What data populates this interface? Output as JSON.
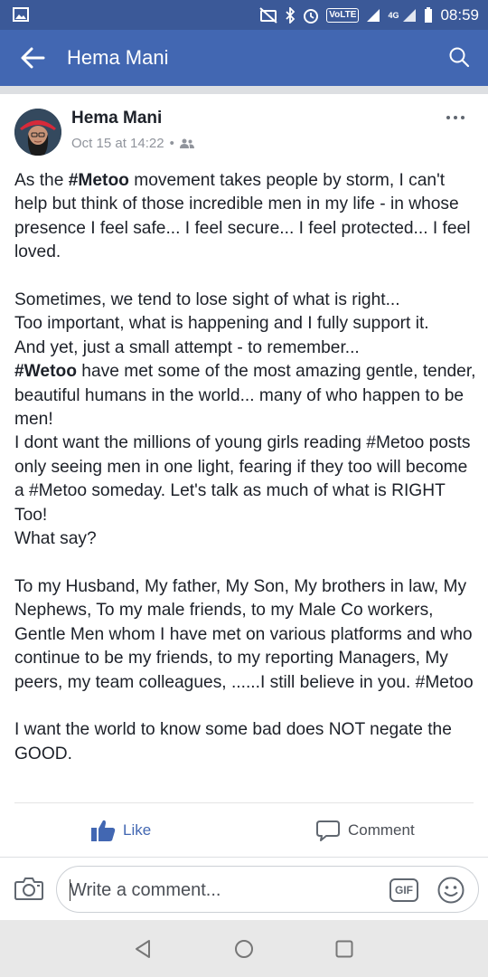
{
  "status_bar": {
    "volte": "VoLTE",
    "network": "4G",
    "time": "08:59"
  },
  "nav": {
    "title": "Hema Mani",
    "back_icon": "arrow-left-icon",
    "search_icon": "search-icon"
  },
  "post": {
    "author": "Hema Mani",
    "timestamp": "Oct 15 at 14:22",
    "separator": "•",
    "privacy_icon": "friends-icon",
    "more_icon": "more-horizontal-icon",
    "paragraph1": {
      "p1": "As the ",
      "tag1": "#Metoo",
      "p2": " movement takes people by storm, I can't help but think of those incredible men in my life - in whose presence I feel safe... I feel secure... I feel protected... I feel loved."
    },
    "paragraph2": {
      "line1": "Sometimes, we tend to lose sight of what is right...",
      "line2": "Too important, what is happening and I fully support it.",
      "line3": "And yet, just a small attempt - to remember...",
      "tag2": "#Wetoo",
      "line4": " have met some of the most amazing gentle, tender, beautiful humans in the world... many of who happen to be men!",
      "line5": "I dont want the millions of young girls reading #Metoo posts only seeing men in one light, fearing if they too will become a #Metoo someday. Let's talk as much of what is RIGHT Too!",
      "line6": "What say?"
    },
    "paragraph3": "To my Husband, My father, My Son, My brothers in law, My Nephews, To my male friends, to my Male Co workers, Gentle Men whom I have met on various platforms and who continue to be my friends, to my reporting Managers, My peers, my team colleagues, ......I still believe in you. #Metoo",
    "paragraph4": "I want the world to know some bad does NOT negate the GOOD.",
    "like_label": "Like",
    "comment_label": "Comment"
  },
  "composer": {
    "placeholder": "Write a comment...",
    "gif_label": "GIF"
  },
  "colors": {
    "status_bar": "#3b5998",
    "nav_bar": "#4267b2",
    "like_blue": "#4267b2"
  }
}
